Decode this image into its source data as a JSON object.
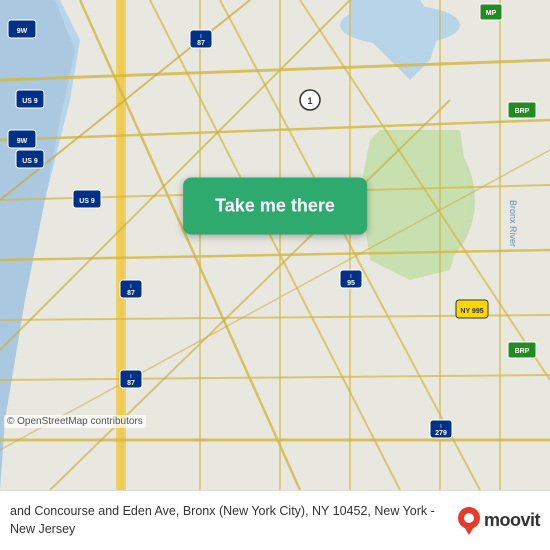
{
  "map": {
    "background_color": "#e8e0d8",
    "osm_credit": "© OpenStreetMap contributors"
  },
  "button": {
    "label": "Take me there",
    "pin_icon": "map-pin"
  },
  "footer": {
    "address": "and Concourse and Eden Ave, Bronx (New York City), NY 10452, New York - New Jersey",
    "brand": "moovit"
  }
}
